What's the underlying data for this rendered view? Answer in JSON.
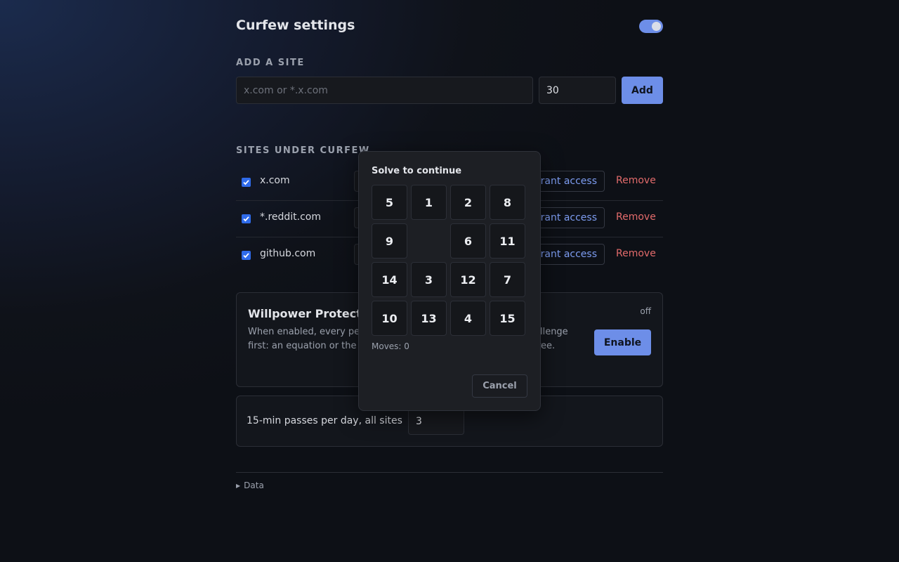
{
  "header": {
    "title": "Curfew settings",
    "enabled": true
  },
  "add_site": {
    "label": "ADD A SITE",
    "domain_placeholder": "x.com or *.x.com",
    "minutes_value": "30",
    "add_label": "Add"
  },
  "sites": {
    "label": "SITES UNDER CURFEW",
    "items": [
      {
        "domain": "x.com",
        "checked": true,
        "grant_label": "rant access",
        "remove_label": "Remove"
      },
      {
        "domain": "*.reddit.com",
        "checked": true,
        "grant_label": "rant access",
        "remove_label": "Remove"
      },
      {
        "domain": "github.com",
        "checked": true,
        "grant_label": "rant access",
        "remove_label": "Remove"
      }
    ]
  },
  "willpower": {
    "title": "Willpower Protecti",
    "status": "off",
    "desc_line1_left": "When enabled, every pe",
    "desc_line1_right": "allenge",
    "desc_line2_left": "first: an equation or the",
    "desc_line2_right": "ree.",
    "enable_label": "Enable"
  },
  "passes": {
    "label": "15-min passes per day, all sites",
    "value": "3"
  },
  "data_section": {
    "label": "Data"
  },
  "puzzle": {
    "title": "Solve to continue",
    "tiles": [
      "5",
      "1",
      "2",
      "8",
      "9",
      "",
      "6",
      "11",
      "14",
      "3",
      "12",
      "7",
      "10",
      "13",
      "4",
      "15"
    ],
    "moves_label": "Moves: 0",
    "cancel_label": "Cancel"
  },
  "colors": {
    "accent": "#6d8ee8",
    "danger": "#e26b6b",
    "link": "#7d9cf0",
    "checkbox": "#2f6bea"
  }
}
